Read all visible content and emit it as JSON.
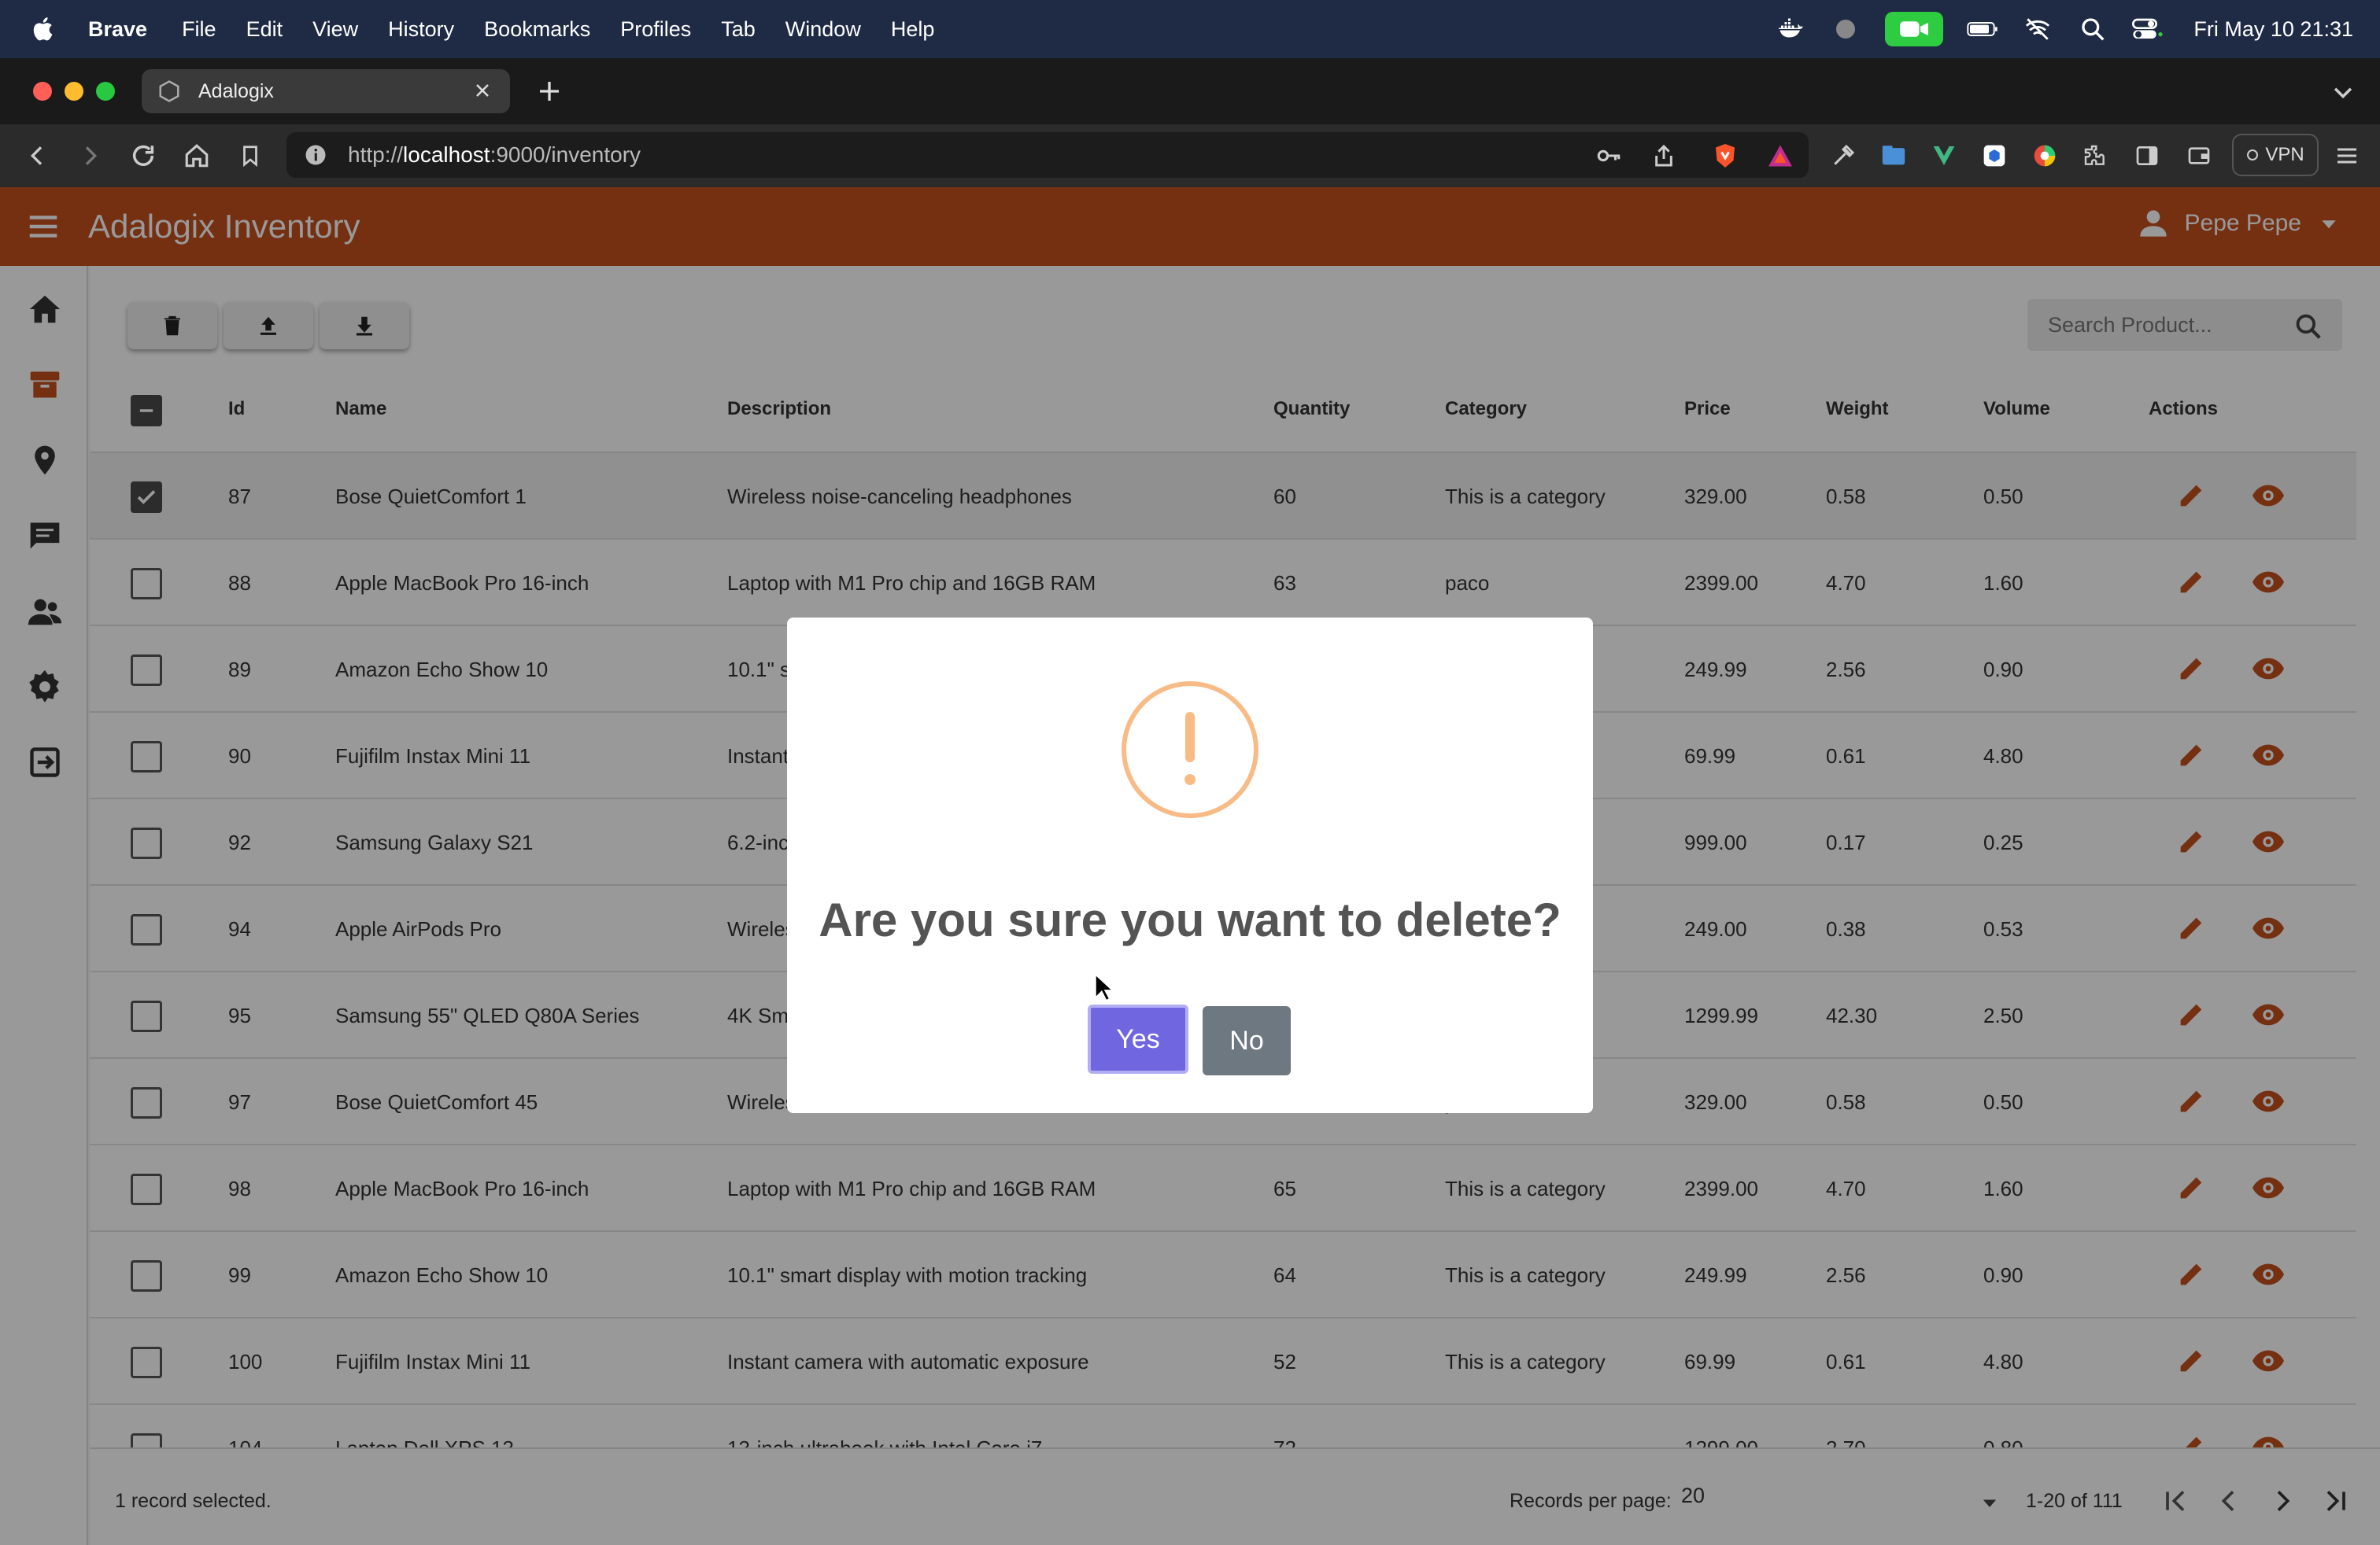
{
  "menubar": {
    "app_name": "Brave",
    "items": [
      "File",
      "Edit",
      "View",
      "History",
      "Bookmarks",
      "Profiles",
      "Tab",
      "Window",
      "Help"
    ],
    "clock": "Fri May 10  21:31"
  },
  "browser": {
    "tab_title": "Adalogix",
    "url_prefix": "http://",
    "url_host": "localhost",
    "url_rest": ":9000/inventory",
    "vpn_label": "VPN"
  },
  "app": {
    "title": "Adalogix Inventory",
    "user_name": "Pepe Pepe",
    "accent_color": "#c4501f",
    "search_placeholder": "Search Product...",
    "columns": [
      "Id",
      "Name",
      "Description",
      "Quantity",
      "Category",
      "Price",
      "Weight",
      "Volume",
      "Actions"
    ],
    "rows": [
      {
        "id": "87",
        "name": "Bose QuietComfort 1",
        "description": "Wireless noise-canceling headphones",
        "quantity": "60",
        "category": "This is a category",
        "price": "329.00",
        "weight": "0.58",
        "volume": "0.50",
        "checked": true
      },
      {
        "id": "88",
        "name": "Apple MacBook Pro 16-inch",
        "description": "Laptop with M1 Pro chip and 16GB RAM",
        "quantity": "63",
        "category": "paco",
        "price": "2399.00",
        "weight": "4.70",
        "volume": "1.60",
        "checked": false
      },
      {
        "id": "89",
        "name": "Amazon Echo Show 10",
        "description": "10.1\" s",
        "quantity": "",
        "category": "y",
        "price": "249.99",
        "weight": "2.56",
        "volume": "0.90",
        "checked": false
      },
      {
        "id": "90",
        "name": "Fujifilm Instax Mini 11",
        "description": "Instant",
        "quantity": "",
        "category": "y",
        "price": "69.99",
        "weight": "0.61",
        "volume": "4.80",
        "checked": false
      },
      {
        "id": "92",
        "name": "Samsung Galaxy S21",
        "description": "6.2-inc",
        "quantity": "",
        "category": "y",
        "price": "999.00",
        "weight": "0.17",
        "volume": "0.25",
        "checked": false
      },
      {
        "id": "94",
        "name": "Apple AirPods Pro",
        "description": "Wireles",
        "quantity": "",
        "category": "y",
        "price": "249.00",
        "weight": "0.38",
        "volume": "0.53",
        "checked": false
      },
      {
        "id": "95",
        "name": "Samsung 55\" QLED Q80A Series",
        "description": "4K Sm",
        "quantity": "",
        "category": "y",
        "price": "1299.99",
        "weight": "42.30",
        "volume": "2.50",
        "checked": false
      },
      {
        "id": "97",
        "name": "Bose QuietComfort 45",
        "description": "Wireles",
        "quantity": "",
        "category": "y",
        "price": "329.00",
        "weight": "0.58",
        "volume": "0.50",
        "checked": false
      },
      {
        "id": "98",
        "name": "Apple MacBook Pro 16-inch",
        "description": "Laptop with M1 Pro chip and 16GB RAM",
        "quantity": "65",
        "category": "This is a category",
        "price": "2399.00",
        "weight": "4.70",
        "volume": "1.60",
        "checked": false
      },
      {
        "id": "99",
        "name": "Amazon Echo Show 10",
        "description": "10.1\" smart display with motion tracking",
        "quantity": "64",
        "category": "This is a category",
        "price": "249.99",
        "weight": "2.56",
        "volume": "0.90",
        "checked": false
      },
      {
        "id": "100",
        "name": "Fujifilm Instax Mini 11",
        "description": "Instant camera with automatic exposure",
        "quantity": "52",
        "category": "This is a category",
        "price": "69.99",
        "weight": "0.61",
        "volume": "4.80",
        "checked": false
      },
      {
        "id": "104",
        "name": "Laptop Dell XPS 13",
        "description": "13-inch ultrabook with Intel Core i7",
        "quantity": "72",
        "category": "",
        "price": "1299.00",
        "weight": "2.70",
        "volume": "0.80",
        "checked": false
      }
    ],
    "footer": {
      "selected_text": "1 record selected.",
      "rows_per_page_label": "Records per page:",
      "rows_per_page_value": "20",
      "range_text": "1-20 of 111"
    }
  },
  "dialog": {
    "message": "Are you sure you want to delete?",
    "yes_label": "Yes",
    "no_label": "No",
    "confirm_color": "#7066e0",
    "cancel_color": "#6e7881",
    "warning_color": "#f8bb86"
  }
}
